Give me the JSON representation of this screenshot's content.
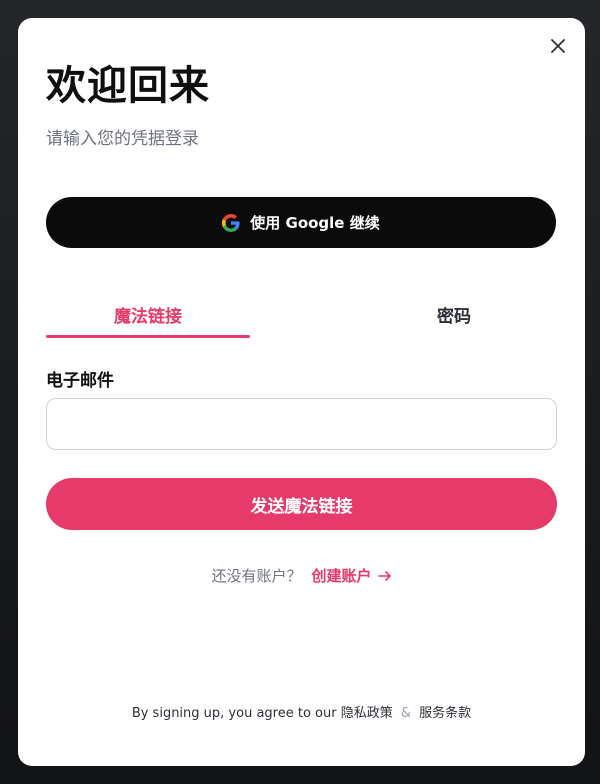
{
  "modal": {
    "title": "欢迎回来",
    "subtitle": "请输入您的凭据登录",
    "close_icon": "close-icon"
  },
  "google": {
    "label": "使用 Google 继续",
    "icon": "google-icon"
  },
  "tabs": [
    {
      "label": "魔法链接",
      "active": true
    },
    {
      "label": "密码",
      "active": false
    }
  ],
  "form": {
    "email_label": "电子邮件",
    "email_value": "",
    "submit_label": "发送魔法链接"
  },
  "signup": {
    "question": "还没有账户？",
    "link_label": "创建账户",
    "arrow_icon": "arrow-right-icon"
  },
  "footer": {
    "prefix": "By signing up, you agree to our",
    "privacy_label": "隐私政策",
    "amp": "&",
    "terms_label": "服务条款"
  },
  "colors": {
    "accent": "#e63a6a",
    "dark_button": "#0b0b0c",
    "muted_text": "#6f7380"
  }
}
